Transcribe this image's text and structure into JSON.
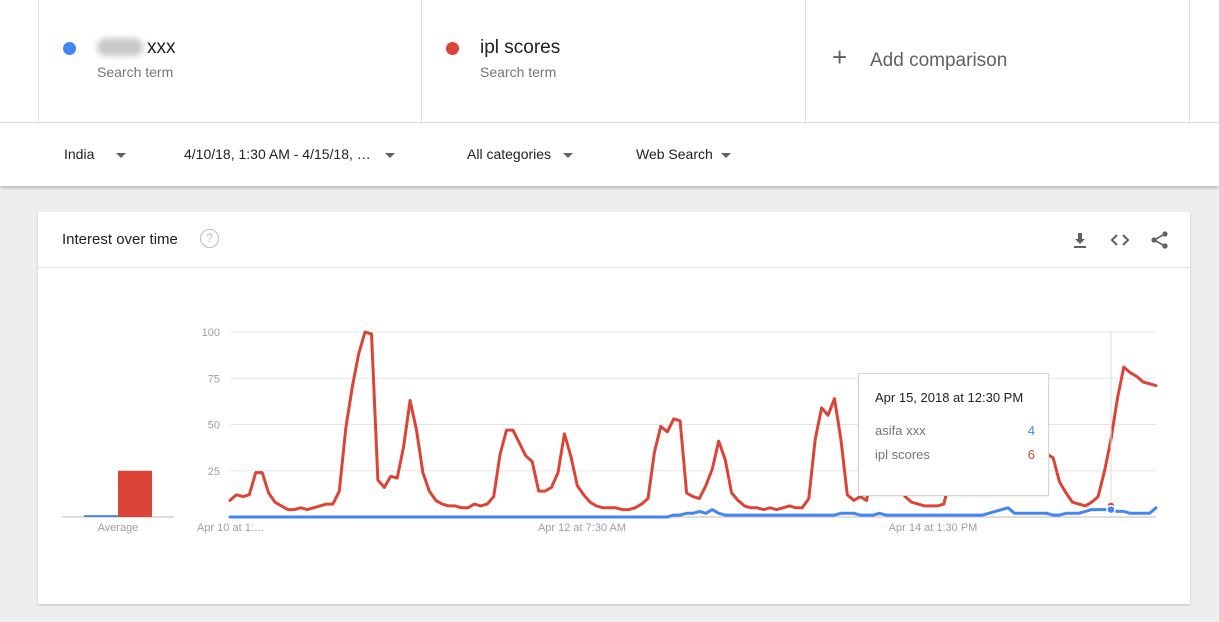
{
  "terms": [
    {
      "name": "xxx",
      "subtitle": "Search term",
      "color": "#4285f4"
    },
    {
      "name": "ipl scores",
      "subtitle": "Search term",
      "color": "#db4437"
    }
  ],
  "add_comparison": {
    "icon": "plus-icon",
    "label": "Add comparison"
  },
  "filters": {
    "region": "India",
    "time_range": "4/10/18, 1:30 AM - 4/15/18, …",
    "category": "All categories",
    "search_type": "Web Search"
  },
  "card": {
    "title": "Interest over time",
    "help_icon": "help-circle-icon",
    "actions": [
      "download-icon",
      "embed-icon",
      "share-icon"
    ]
  },
  "chart_data": [
    {
      "type": "bar",
      "categories": [
        "Average"
      ],
      "series": [
        {
          "name": "xxx",
          "values": [
            1
          ],
          "color": "#4285f4"
        },
        {
          "name": "ipl scores",
          "values": [
            25
          ],
          "color": "#db4437"
        }
      ],
      "ylim": [
        0,
        100
      ]
    },
    {
      "type": "line",
      "x_tick_labels": [
        "Apr 10 at 1:…",
        "Apr 12 at 7:30 AM",
        "Apr 14 at 1:30 PM"
      ],
      "y_ticks": [
        25,
        50,
        75,
        100
      ],
      "ylim": [
        0,
        100
      ],
      "grid": true,
      "series": [
        {
          "name": "ipl scores",
          "color": "#db4437",
          "values": [
            9,
            12,
            11,
            12,
            24,
            24,
            13,
            8,
            6,
            4,
            4,
            5,
            4,
            5,
            6,
            7,
            7,
            14,
            48,
            70,
            88,
            100,
            99,
            20,
            16,
            22,
            21,
            38,
            63,
            47,
            24,
            14,
            9,
            7,
            6,
            6,
            5,
            5,
            7,
            6,
            7,
            11,
            34,
            47,
            47,
            40,
            33,
            30,
            14,
            14,
            16,
            24,
            45,
            33,
            17,
            12,
            8,
            6,
            5,
            5,
            5,
            4,
            4,
            5,
            7,
            10,
            35,
            49,
            46,
            53,
            52,
            13,
            11,
            10,
            17,
            26,
            41,
            31,
            13,
            9,
            6,
            5,
            5,
            4,
            5,
            4,
            5,
            6,
            5,
            5,
            10,
            42,
            59,
            55,
            64,
            42,
            12,
            9,
            11,
            9,
            29,
            31,
            30,
            27,
            17,
            11,
            8,
            7,
            6,
            6,
            6,
            7,
            21,
            44,
            49,
            61,
            73,
            59,
            52,
            45,
            47,
            33,
            16,
            20,
            21,
            22,
            25,
            34,
            32,
            19,
            13,
            8,
            7,
            6,
            8,
            11,
            25,
            42,
            64,
            81,
            78,
            76,
            73,
            72,
            71
          ],
          "tooltip_value": 6
        },
        {
          "name": "asifa xxx",
          "color": "#4285f4",
          "values": [
            0,
            0,
            0,
            0,
            0,
            0,
            0,
            0,
            0,
            0,
            0,
            0,
            0,
            0,
            0,
            0,
            0,
            0,
            0,
            0,
            0,
            0,
            0,
            0,
            0,
            0,
            0,
            0,
            0,
            0,
            0,
            0,
            0,
            0,
            0,
            0,
            0,
            0,
            0,
            0,
            0,
            0,
            0,
            0,
            0,
            0,
            0,
            0,
            0,
            0,
            0,
            0,
            0,
            0,
            0,
            0,
            0,
            0,
            0,
            0,
            0,
            0,
            0,
            0,
            0,
            0,
            0,
            0,
            0,
            1,
            1,
            2,
            2,
            3,
            2,
            4,
            2,
            1,
            1,
            1,
            1,
            1,
            1,
            1,
            1,
            1,
            1,
            1,
            1,
            1,
            1,
            1,
            1,
            1,
            1,
            2,
            2,
            2,
            1,
            1,
            1,
            2,
            1,
            1,
            1,
            1,
            1,
            1,
            1,
            1,
            1,
            1,
            1,
            1,
            1,
            1,
            1,
            1,
            2,
            3,
            4,
            5,
            2,
            2,
            2,
            2,
            2,
            2,
            1,
            1,
            2,
            2,
            2,
            3,
            4,
            4,
            4,
            4,
            3,
            3,
            2,
            2,
            2,
            2,
            5
          ],
          "tooltip_value": 4
        }
      ],
      "tooltip": {
        "date": "Apr 15, 2018 at 12:30 PM",
        "rows": [
          {
            "name": "asifa xxx",
            "value": "4",
            "color": "#4285f4"
          },
          {
            "name": "ipl scores",
            "value": "6",
            "color": "#db4437"
          }
        ],
        "hover_index": 137
      }
    }
  ]
}
